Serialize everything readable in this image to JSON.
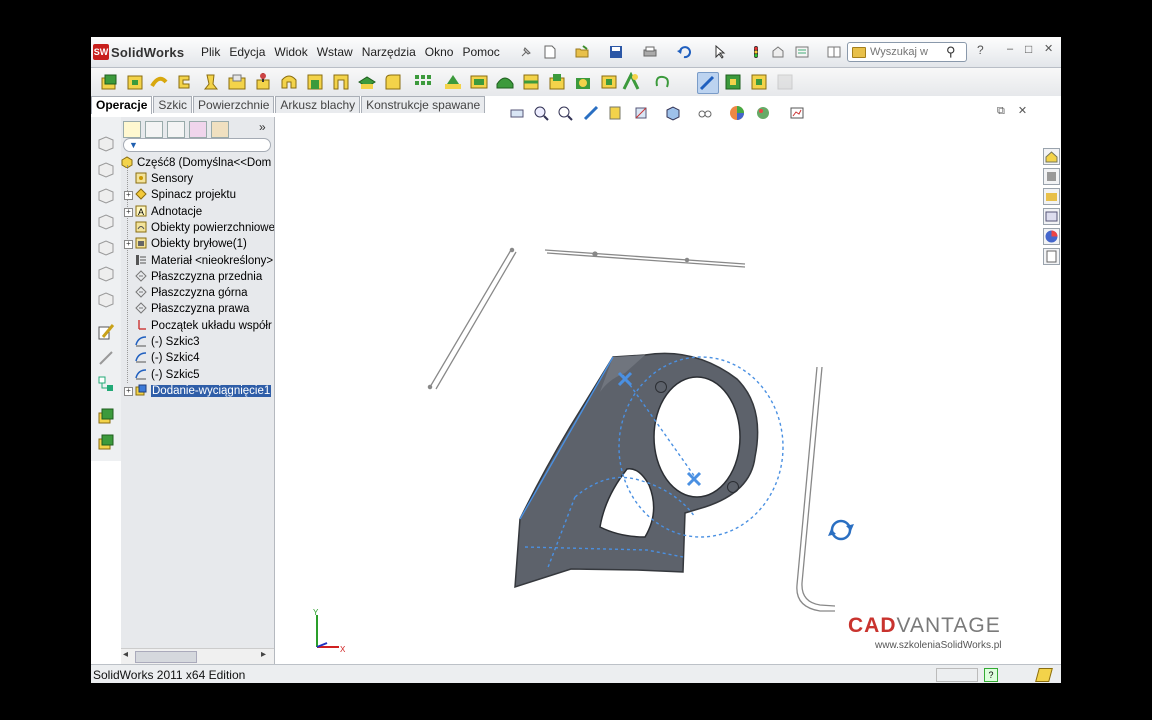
{
  "app": {
    "brand_badge": "SW",
    "name": "SolidWorks"
  },
  "menu": [
    "Plik",
    "Edycja",
    "Widok",
    "Wstaw",
    "Narzędzia",
    "Okno",
    "Pomoc"
  ],
  "search": {
    "placeholder": "Wyszukaj w"
  },
  "tabs": [
    {
      "label": "Operacje",
      "active": true
    },
    {
      "label": "Szkic"
    },
    {
      "label": "Powierzchnie"
    },
    {
      "label": "Arkusz blachy"
    },
    {
      "label": "Konstrukcje spawane"
    }
  ],
  "tree": {
    "root": "Część8  (Domyślna<<Dom",
    "items": [
      {
        "label": "Sensory",
        "icon": "sensors-icon"
      },
      {
        "label": "Spinacz projektu",
        "icon": "design-binder-icon",
        "expandable": true
      },
      {
        "label": "Adnotacje",
        "icon": "annotations-icon",
        "expandable": true
      },
      {
        "label": "Obiekty powierzchniowe",
        "icon": "surface-bodies-icon"
      },
      {
        "label": "Obiekty bryłowe(1)",
        "icon": "solid-bodies-icon",
        "expandable": true
      },
      {
        "label": "Materiał <nieokreślony>",
        "icon": "material-icon"
      },
      {
        "label": "Płaszczyzna przednia",
        "icon": "plane-icon"
      },
      {
        "label": "Płaszczyzna górna",
        "icon": "plane-icon"
      },
      {
        "label": "Płaszczyzna prawa",
        "icon": "plane-icon"
      },
      {
        "label": "Początek układu współr",
        "icon": "origin-icon"
      },
      {
        "label": "(-) Szkic3",
        "icon": "sketch-icon"
      },
      {
        "label": "(-) Szkic4",
        "icon": "sketch-icon"
      },
      {
        "label": "(-) Szkic5",
        "icon": "sketch-icon"
      },
      {
        "label": "Dodanie-wyciągnięcie1",
        "icon": "extrude-icon",
        "expandable": true,
        "selected": true
      }
    ],
    "collapse_label": "»"
  },
  "window_controls": {
    "help": "?",
    "minimize": "–",
    "restore": "□",
    "close": "✕"
  },
  "viewport_controls": {
    "restore": "⧉",
    "close": "✕"
  },
  "status": {
    "text": "SolidWorks 2011 x64 Edition"
  },
  "watermark": {
    "cad": "CAD",
    "vantage": "VANTAGE",
    "url": "www.szkoleniaSolidWorks.pl"
  },
  "colors": {
    "part": "#5c616a",
    "sketch": "#4a90e2",
    "accent": "#2f5ea8",
    "brand_red": "#c9332e"
  }
}
